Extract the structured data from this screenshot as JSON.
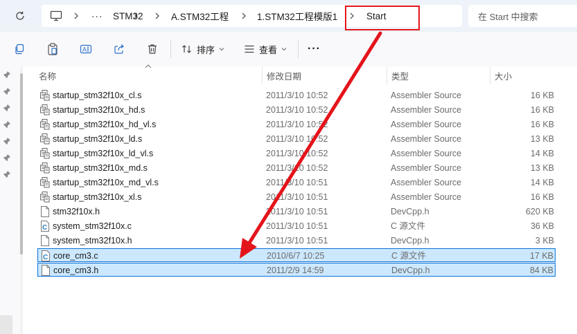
{
  "breadcrumb": {
    "ellipsis": "···",
    "items": [
      "STM32",
      "A.STM32工程",
      "1.STM32工程模版1",
      "Start"
    ]
  },
  "search": {
    "placeholder": "在 Start 中搜索"
  },
  "toolbar": {
    "sort_label": "排序",
    "view_label": "查看",
    "more_label": "···"
  },
  "columns": {
    "name": "名称",
    "date": "修改日期",
    "type": "类型",
    "size": "大小"
  },
  "files": [
    {
      "name": "startup_stm32f10x_cl.s",
      "date": "2011/3/10 10:52",
      "type": "Assembler Source",
      "size": "16 KB",
      "icon": "assembler-file-icon"
    },
    {
      "name": "startup_stm32f10x_hd.s",
      "date": "2011/3/10 10:52",
      "type": "Assembler Source",
      "size": "16 KB",
      "icon": "assembler-file-icon"
    },
    {
      "name": "startup_stm32f10x_hd_vl.s",
      "date": "2011/3/10 10:52",
      "type": "Assembler Source",
      "size": "16 KB",
      "icon": "assembler-file-icon"
    },
    {
      "name": "startup_stm32f10x_ld.s",
      "date": "2011/3/10 10:52",
      "type": "Assembler Source",
      "size": "13 KB",
      "icon": "assembler-file-icon"
    },
    {
      "name": "startup_stm32f10x_ld_vl.s",
      "date": "2011/3/10 10:52",
      "type": "Assembler Source",
      "size": "14 KB",
      "icon": "assembler-file-icon"
    },
    {
      "name": "startup_stm32f10x_md.s",
      "date": "2011/3/10 10:52",
      "type": "Assembler Source",
      "size": "13 KB",
      "icon": "assembler-file-icon"
    },
    {
      "name": "startup_stm32f10x_md_vl.s",
      "date": "2011/3/10 10:51",
      "type": "Assembler Source",
      "size": "14 KB",
      "icon": "assembler-file-icon"
    },
    {
      "name": "startup_stm32f10x_xl.s",
      "date": "2011/3/10 10:51",
      "type": "Assembler Source",
      "size": "16 KB",
      "icon": "assembler-file-icon"
    },
    {
      "name": "stm32f10x.h",
      "date": "2011/3/10 10:51",
      "type": "DevCpp.h",
      "size": "620 KB",
      "icon": "header-file-icon"
    },
    {
      "name": "system_stm32f10x.c",
      "date": "2011/3/10 10:51",
      "type": "C 源文件",
      "size": "36 KB",
      "icon": "c-source-file-icon"
    },
    {
      "name": "system_stm32f10x.h",
      "date": "2011/3/10 10:51",
      "type": "DevCpp.h",
      "size": "3 KB",
      "icon": "header-file-icon"
    },
    {
      "name": "core_cm3.c",
      "date": "2010/6/7 10:25",
      "type": "C 源文件",
      "size": "17 KB",
      "icon": "c-source-file-icon",
      "selected": true
    },
    {
      "name": "core_cm3.h",
      "date": "2011/2/9 14:59",
      "type": "DevCpp.h",
      "size": "84 KB",
      "icon": "header-file-icon",
      "selected": true
    }
  ],
  "colors": {
    "highlight": "#e4141b",
    "selection_bg": "#cce8ff",
    "selection_border": "#0a72d6",
    "c_icon": "#2a7fc1"
  }
}
